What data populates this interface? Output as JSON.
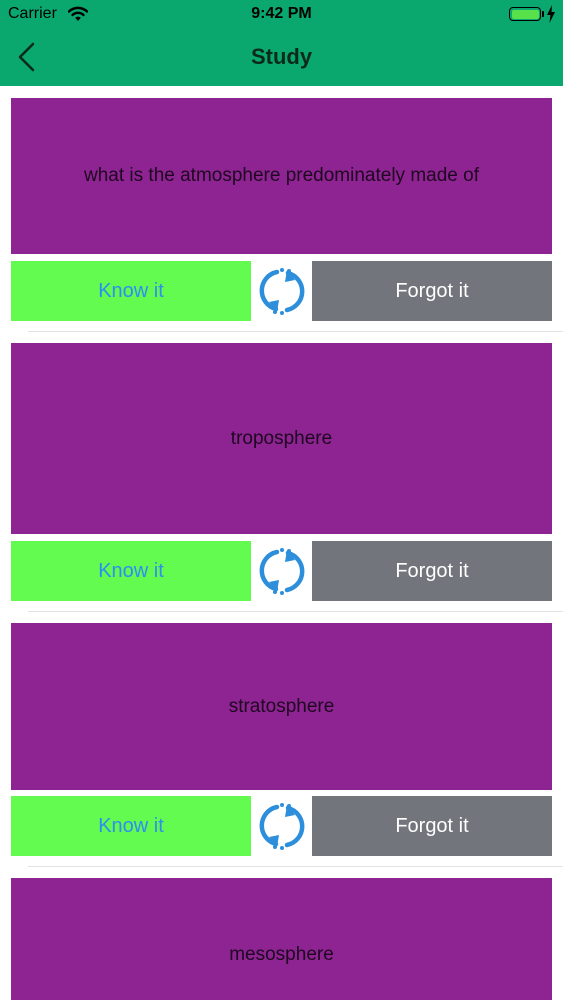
{
  "status_bar": {
    "carrier": "Carrier",
    "time": "9:42 PM"
  },
  "navbar": {
    "title": "Study",
    "back_icon": "chevron-left-icon"
  },
  "colors": {
    "navbar_bg": "#0aa86e",
    "card_bg": "#8e2392",
    "know_bg": "#63fb4f",
    "know_text": "#2e8ef0",
    "forgot_bg": "#73757c",
    "flip_icon": "#2d8fdc"
  },
  "cards": [
    {
      "text": "what is the atmosphere predominately made of",
      "know_label": "Know it",
      "forgot_label": "Forgot it",
      "flip_icon": "refresh-icon"
    },
    {
      "text": "troposphere",
      "know_label": "Know it",
      "forgot_label": "Forgot it",
      "flip_icon": "refresh-icon"
    },
    {
      "text": "stratosphere",
      "know_label": "Know it",
      "forgot_label": "Forgot it",
      "flip_icon": "refresh-icon"
    },
    {
      "text": "mesosphere"
    }
  ]
}
